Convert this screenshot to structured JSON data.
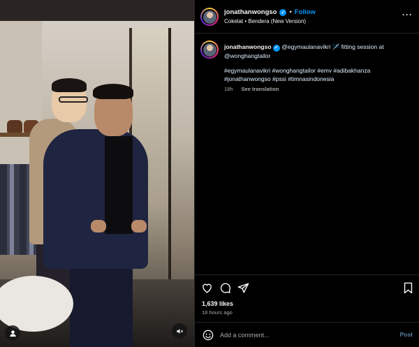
{
  "media": {
    "user_tag_icon": "user-icon",
    "mute_icon": "speaker-muted-icon"
  },
  "header": {
    "username": "jonathanwongso",
    "separator": "•",
    "follow_label": "Follow",
    "audio": "Cokelat • Bendera (New Version)",
    "more_label": "···"
  },
  "caption": {
    "username": "jonathanwongso",
    "text": "@egymaulanavikri 🪡 fitting session at @wonghangtailor",
    "hashtags": "#egymaulanavikri #wonghangtailor #emv #adibakhanza #jonathanwongso #pssi #timnasindonesia",
    "time": "18h",
    "see_translation": "See translation"
  },
  "actions": {
    "like_icon": "heart-icon",
    "comment_icon": "comment-icon",
    "share_icon": "send-icon",
    "save_icon": "bookmark-icon",
    "likes": "1,639 likes",
    "ago": "18 hours ago"
  },
  "comment": {
    "emoji_icon": "emoji-icon",
    "placeholder": "Add a comment...",
    "post_label": "Post"
  },
  "colors": {
    "accent": "#0095f6",
    "panel_bg": "#000000",
    "muted_text": "#a8a8a8"
  }
}
